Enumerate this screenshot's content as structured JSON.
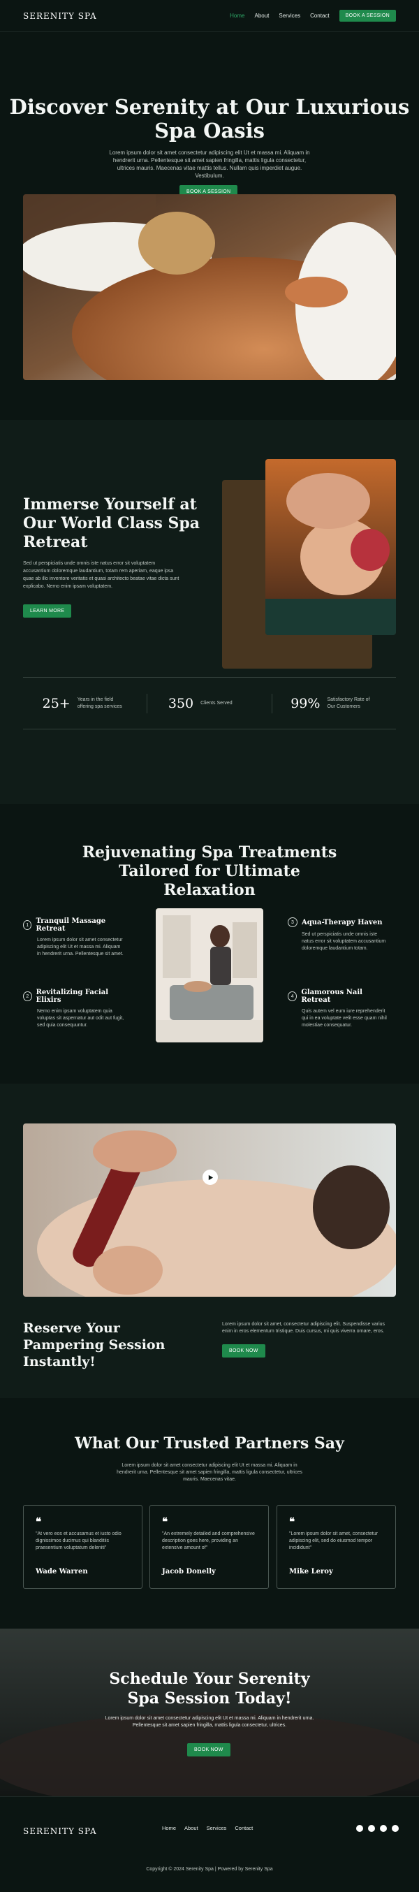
{
  "nav": {
    "brand": "SERENITY SPA",
    "links": [
      "Home",
      "About",
      "Services",
      "Contact"
    ],
    "cta": "BOOK A SESSION"
  },
  "hero": {
    "title": "Discover Serenity at Our Luxurious Spa Oasis",
    "text": "Lorem ipsum dolor sit amet consectetur adipiscing elit Ut et massa mi. Aliquam in hendrerit urna. Pellentesque sit amet sapien fringilla, mattis ligula consectetur, ultrices mauris. Maecenas vitae mattis tellus. Nullam quis imperdiet augue. Vestibulum.",
    "cta": "BOOK A SESSION"
  },
  "immerse": {
    "title": "Immerse Yourself at Our World Class Spa Retreat",
    "text": "Sed ut perspiciatis unde omnis iste natus error sit voluptatem accusantium doloremque laudantium, totam rem aperiam, eaque ipsa quae ab illo inventore veritatis et quasi architecto beatae vitae dicta sunt explicabo. Nemo enim ipsam voluptatem.",
    "cta": "LEARN MORE",
    "stats": [
      {
        "num": "25+",
        "label": "Years in the field offering spa services"
      },
      {
        "num": "350",
        "label": "Clients Served"
      },
      {
        "num": "99%",
        "label": "Satisfactory Rate of Our Customers"
      }
    ]
  },
  "treatments": {
    "title": "Rejuvenating Spa Treatments Tailored for Ultimate Relaxation",
    "items": [
      {
        "n": "1",
        "title": "Tranquil Massage Retreat",
        "text": "Lorem ipsum dolor sit amet consectetur adipiscing elit Ut et massa mi. Aliquam in hendrerit urna. Pellentesque sit amet."
      },
      {
        "n": "2",
        "title": "Revitalizing Facial Elixirs",
        "text": "Nemo enim ipsam voluptatem quia voluptas sit aspernatur aut odit aut fugit, sed quia consequuntur."
      },
      {
        "n": "3",
        "title": "Aqua-Therapy Haven",
        "text": "Sed ut perspiciatis unde omnis iste natus error sit voluptatem accusantium doloremque laudantium totam."
      },
      {
        "n": "4",
        "title": "Glamorous Nail Retreat",
        "text": "Quis autem vel eum iure reprehenderit qui in ea voluptate velit esse quam nihil molestiae consequatur."
      }
    ]
  },
  "reserve": {
    "title": "Reserve Your Pampering Session Instantly!",
    "text": "Lorem ipsum dolor sit amet, consectetur adipiscing elit. Suspendisse varius enim in eros elementum tristique. Duis cursus, mi quis viverra ornare, eros.",
    "cta": "BOOK NOW"
  },
  "testimonials": {
    "title": "What Our Trusted Partners Say",
    "text": "Lorem ipsum dolor sit amet consectetur adipiscing elit Ut et massa mi. Aliquam in hendrerit urna. Pellentesque sit amet sapien fringilla, mattis ligula consectetur, ultrices mauris. Maecenas vitae.",
    "items": [
      {
        "quote": "\"At vero eos et accusamus et iusto odio dignissimos ducimus qui blanditiis praesentium voluptatum deleniti\"",
        "name": "Wade Warren"
      },
      {
        "quote": "\"An extremely detailed and comprehensive description goes here, providing an extensive amount of\"",
        "name": "Jacob Donelly"
      },
      {
        "quote": "\"Lorem ipsum dolor sit amet, consectetur adipiscing elit, sed do eiusmod tempor incididunt\"",
        "name": "Mike Leroy"
      }
    ]
  },
  "cta": {
    "title": "Schedule Your Serenity Spa Session Today!",
    "text": "Lorem ipsum dolor sit amet consectetur adipiscing elit Ut et massa mi. Aliquam in hendrerit urna. Pellentesque sit amet sapien fringilla, mattis ligula consectetur, ultrices.",
    "button": "BOOK NOW"
  },
  "footer": {
    "brand": "SERENITY SPA",
    "links": [
      "Home",
      "About",
      "Services",
      "Contact"
    ],
    "copyright": "Copyright © 2024 Serenity Spa | Powered by Serenity Spa",
    "socials": [
      "facebook-icon",
      "instagram-icon",
      "twitter-icon",
      "youtube-icon"
    ]
  },
  "colors": {
    "accent": "#1f8a4c",
    "bg": "#0b1512",
    "panel": "#101c18"
  }
}
